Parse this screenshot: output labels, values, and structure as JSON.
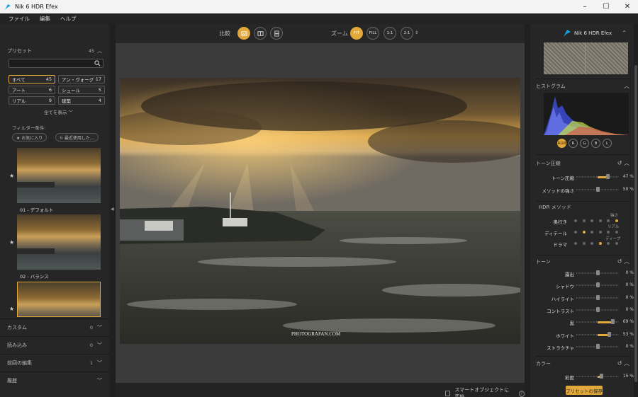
{
  "window": {
    "title": "Nik 6 HDR Efex",
    "minimize": "–",
    "maximize": "☐",
    "close": "✕"
  },
  "menu": [
    "ファイル",
    "編集",
    "ヘルプ"
  ],
  "presets": {
    "title": "プリセット",
    "count": "45",
    "categories": [
      {
        "label": "すべて",
        "count": "45"
      },
      {
        "label": "アン・ヴォーグ",
        "count": "17"
      },
      {
        "label": "アート",
        "count": "6"
      },
      {
        "label": "シュール",
        "count": "5"
      },
      {
        "label": "リアル",
        "count": "9"
      },
      {
        "label": "建築",
        "count": "4"
      }
    ],
    "show_all": "全てを表示",
    "filter_label": "フィルター条件:",
    "favorites": "★ お気に入り",
    "recent": "↻ 最近使用した…",
    "thumbs": [
      {
        "label": "01 - デフォルト"
      },
      {
        "label": "02 - バランス"
      }
    ]
  },
  "left_sections": [
    {
      "label": "カスタム",
      "count": "0"
    },
    {
      "label": "読み込み",
      "count": "0"
    },
    {
      "label": "前回の編集",
      "count": "1"
    },
    {
      "label": "履歴",
      "count": ""
    }
  ],
  "toolbar": {
    "compare_label": "比較",
    "zoom_label": "ズーム",
    "zoom_fit": "FIT",
    "zoom_fill": "FILL",
    "zoom_1": "1:1",
    "zoom_2": "2:1"
  },
  "photo": {
    "watermark": "PHOTOGRAFAN.COM"
  },
  "bottombar": {
    "smart_object": "スマートオブジェクトに変換",
    "help": "?"
  },
  "right": {
    "brand": "Nik 6 HDR Efex",
    "histogram_title": "ヒストグラム",
    "channels": [
      "RGB",
      "R",
      "G",
      "B",
      "L"
    ],
    "tone_compression": {
      "title": "トーン圧縮",
      "sliders": [
        {
          "label": "トーン圧縮",
          "value": "47 %",
          "level": 0.73
        },
        {
          "label": "メソッドの強さ",
          "value": "50 %",
          "level": 0.5
        }
      ]
    },
    "hdr_method": {
      "title": "HDR メソッド",
      "notes": [
        "強さ",
        "リアル",
        "ディープ"
      ],
      "rows": [
        {
          "label": "奥行き",
          "active": 5
        },
        {
          "label": "ディテール",
          "active": 1
        },
        {
          "label": "ドラマ",
          "active": 3
        }
      ]
    },
    "tone": {
      "title": "トーン",
      "sliders": [
        {
          "label": "露出",
          "value": "0 %",
          "level": 0.5
        },
        {
          "label": "シャドウ",
          "value": "0 %",
          "level": 0.5
        },
        {
          "label": "ハイライト",
          "value": "0 %",
          "level": 0.5
        },
        {
          "label": "コントラスト",
          "value": "0 %",
          "level": 0.5
        },
        {
          "label": "黒",
          "value": "69 %",
          "level": 0.85
        },
        {
          "label": "ホワイト",
          "value": "53 %",
          "level": 0.77
        },
        {
          "label": "ストラクチャ",
          "value": "0 %",
          "level": 0.5
        }
      ]
    },
    "color": {
      "title": "カラー",
      "sliders": [
        {
          "label": "彩度",
          "value": "15 %",
          "level": 0.58
        }
      ]
    },
    "save_preset": "プリセットの保存"
  }
}
